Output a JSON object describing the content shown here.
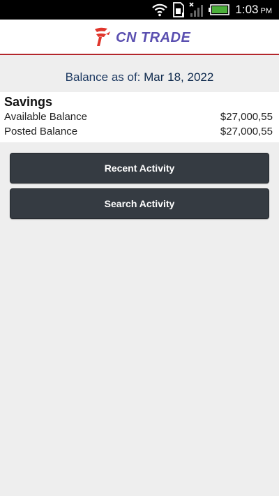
{
  "status_bar": {
    "time": "1:03",
    "ampm": "PM",
    "icons": [
      "wifi-icon",
      "sim-card-icon",
      "no-signal-icon",
      "battery-icon"
    ]
  },
  "header": {
    "logo_text": "CN TRADE",
    "brand_colors": {
      "accent_red": "#e0352b",
      "brand_purple": "#5a4fb0",
      "divider": "#b3262b"
    }
  },
  "balance": {
    "as_of_label": "Balance as of:",
    "as_of_date": "Mar 18, 2022"
  },
  "account": {
    "name": "Savings",
    "available_label": "Available Balance",
    "available_value": "$27,000,55",
    "posted_label": "Posted Balance",
    "posted_value": "$27,000,55"
  },
  "actions": {
    "recent_activity": "Recent Activity",
    "search_activity": "Search Activity"
  }
}
